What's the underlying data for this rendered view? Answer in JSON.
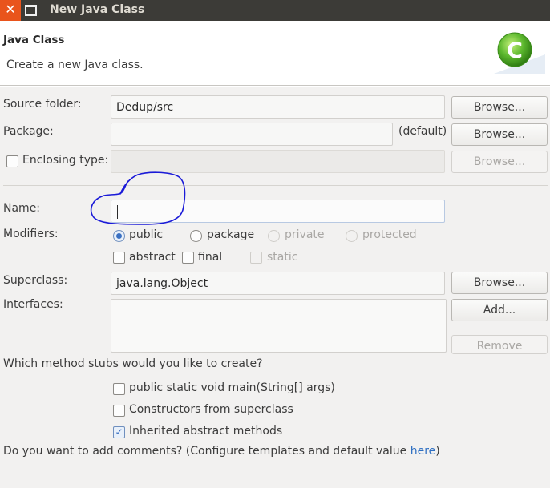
{
  "window": {
    "title": "New Java Class",
    "close_glyph": "✕"
  },
  "header": {
    "title": "Java Class",
    "subtitle": "Create a new Java class.",
    "logo_letter": "C",
    "logo_color": "#5cb82e"
  },
  "source_folder": {
    "label": "Source folder:",
    "value": "Dedup/src",
    "browse": "Browse..."
  },
  "package": {
    "label": "Package:",
    "value": "",
    "default_hint": "(default)",
    "browse": "Browse..."
  },
  "enclosing_type": {
    "label": "Enclosing type:",
    "checked": false,
    "value": "",
    "browse": "Browse..."
  },
  "name": {
    "label": "Name:",
    "value": "",
    "annotation_color": "#1a1ad8"
  },
  "modifiers": {
    "label": "Modifiers:",
    "access": [
      {
        "label": "public",
        "selected": true,
        "enabled": true
      },
      {
        "label": "package",
        "selected": false,
        "enabled": true
      },
      {
        "label": "private",
        "selected": false,
        "enabled": false
      },
      {
        "label": "protected",
        "selected": false,
        "enabled": false
      }
    ],
    "flags": [
      {
        "label": "abstract",
        "checked": false,
        "enabled": true
      },
      {
        "label": "final",
        "checked": false,
        "enabled": true
      },
      {
        "label": "static",
        "checked": false,
        "enabled": false
      }
    ]
  },
  "superclass": {
    "label": "Superclass:",
    "value": "java.lang.Object",
    "browse": "Browse..."
  },
  "interfaces": {
    "label": "Interfaces:",
    "add": "Add...",
    "remove": "Remove"
  },
  "method_stubs": {
    "question": "Which method stubs would you like to create?",
    "options": [
      {
        "label": "public static void main(String[] args)",
        "checked": false
      },
      {
        "label": "Constructors from superclass",
        "checked": false
      },
      {
        "label": "Inherited abstract methods",
        "checked": true
      }
    ]
  },
  "comments": {
    "question_prefix": "Do you want to add comments? (Configure templates and default value ",
    "link": "here",
    "question_suffix": ")"
  },
  "colors": {
    "titlebar": "#3c3b37",
    "close": "#e9541c",
    "accent": "#3a70c2"
  }
}
